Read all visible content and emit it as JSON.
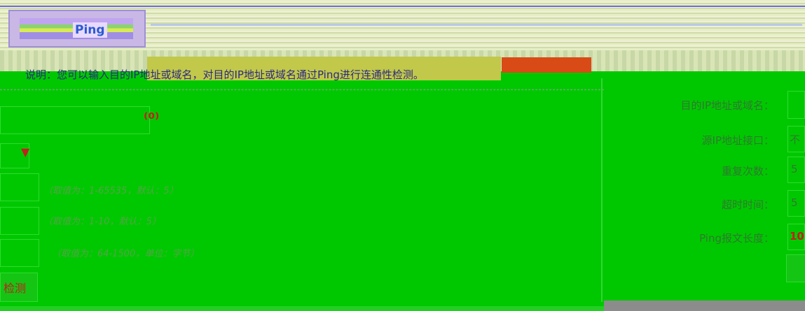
{
  "window": {
    "active_tab": "Ping"
  },
  "notice": {
    "text": "说明：您可以输入目的IP地址或域名，对目的IP地址或域名通过Ping进行连通性检测。"
  },
  "left_form": {
    "hints": [
      "（取值为：1-65535，默认：5）",
      "（取值为：1-10，默认：5）",
      "（取值为：64-1500，单位：字节）"
    ],
    "button_label": "检测"
  },
  "right_form": {
    "fields": [
      {
        "label": "目的IP地址或域名：",
        "value": ""
      },
      {
        "label": "源IP地址接口：",
        "value": "不"
      },
      {
        "label": "重复次数：",
        "value": "5"
      },
      {
        "label": "超时时间：",
        "value": "5"
      },
      {
        "label": "Ping报文长度：",
        "value": "10"
      }
    ]
  }
}
